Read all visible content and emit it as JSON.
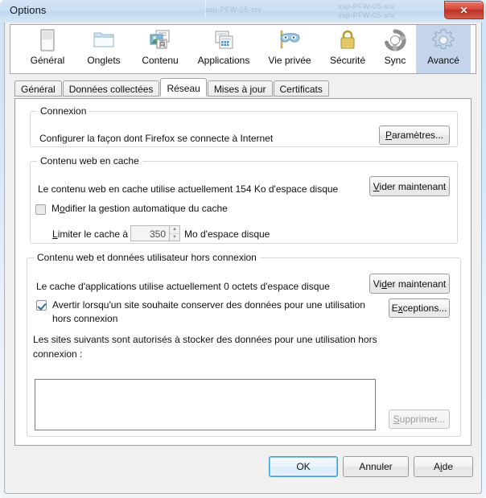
{
  "window": {
    "title": "Options",
    "close_label": "✕",
    "ghost_texts": [
      "ssp-PFW-05-srv",
      "ssp-PFW-05-srv",
      "ssp-PFW-05-srv"
    ]
  },
  "icon_tabs": [
    {
      "label": "Général",
      "icon": "window-pane-icon"
    },
    {
      "label": "Onglets",
      "icon": "folder-tabs-icon"
    },
    {
      "label": "Contenu",
      "icon": "content-page-icon"
    },
    {
      "label": "Applications",
      "icon": "applications-grid-icon"
    },
    {
      "label": "Vie privée",
      "icon": "privacy-mask-icon"
    },
    {
      "label": "Sécurité",
      "icon": "padlock-icon"
    },
    {
      "label": "Sync",
      "icon": "sync-arrows-icon"
    },
    {
      "label": "Avancé",
      "icon": "gear-icon"
    }
  ],
  "selected_icon_tab": "Avancé",
  "sub_tabs": [
    {
      "label": "Général"
    },
    {
      "label": "Données collectées"
    },
    {
      "label": "Réseau"
    },
    {
      "label": "Mises à jour"
    },
    {
      "label": "Certificats"
    }
  ],
  "selected_sub_tab": "Réseau",
  "groups": {
    "connection": {
      "legend": "Connexion",
      "description": "Configurer la façon dont Firefox se connecte à Internet",
      "settings_button": {
        "pre": "P",
        "post": "aramètres..."
      }
    },
    "cache": {
      "legend": "Contenu web en cache",
      "usage_text": "Le contenu web en cache utilise actuellement 154 Ko d'espace disque",
      "clear_button": {
        "pre": "V",
        "post": "ider maintenant"
      },
      "override_checkbox": {
        "pre": "M",
        "acc": "o",
        "post": "difier la gestion automatique du cache",
        "checked": false
      },
      "limit_label": {
        "pre": "L",
        "post": "imiter le cache à"
      },
      "limit_value": "350",
      "limit_units": "Mo d'espace disque"
    },
    "offline": {
      "legend": "Contenu web et données utilisateur hors connexion",
      "usage_text": "Le cache d'applications utilise actuellement 0 octets d'espace disque",
      "clear_button": {
        "pre": "Vi",
        "acc": "d",
        "post": "er maintenant"
      },
      "notify_checkbox": {
        "line1": "Avertir lorsqu'un site souhaite conserver des données pour une utilisation",
        "line2": "hors connexion",
        "checked": true
      },
      "exceptions_button": {
        "pre": "E",
        "acc": "x",
        "post": "ceptions..."
      },
      "allowed_sites_label_line1": "Les sites suivants sont autorisés à stocker des données pour une utilisation hors",
      "allowed_sites_label_line2": "connexion :",
      "sites": [],
      "remove_button": {
        "pre": "S",
        "post": "upprimer...",
        "disabled": true
      }
    }
  },
  "footer": {
    "ok": "OK",
    "cancel": "Annuler",
    "help": {
      "pre": "A",
      "acc": "i",
      "post": "de"
    }
  },
  "colors": {
    "accent": "#c3d4ec",
    "default_button_border": "#3c9bd6",
    "close_button": "#bd3325",
    "checkbox_check": "#2a6fb5"
  }
}
